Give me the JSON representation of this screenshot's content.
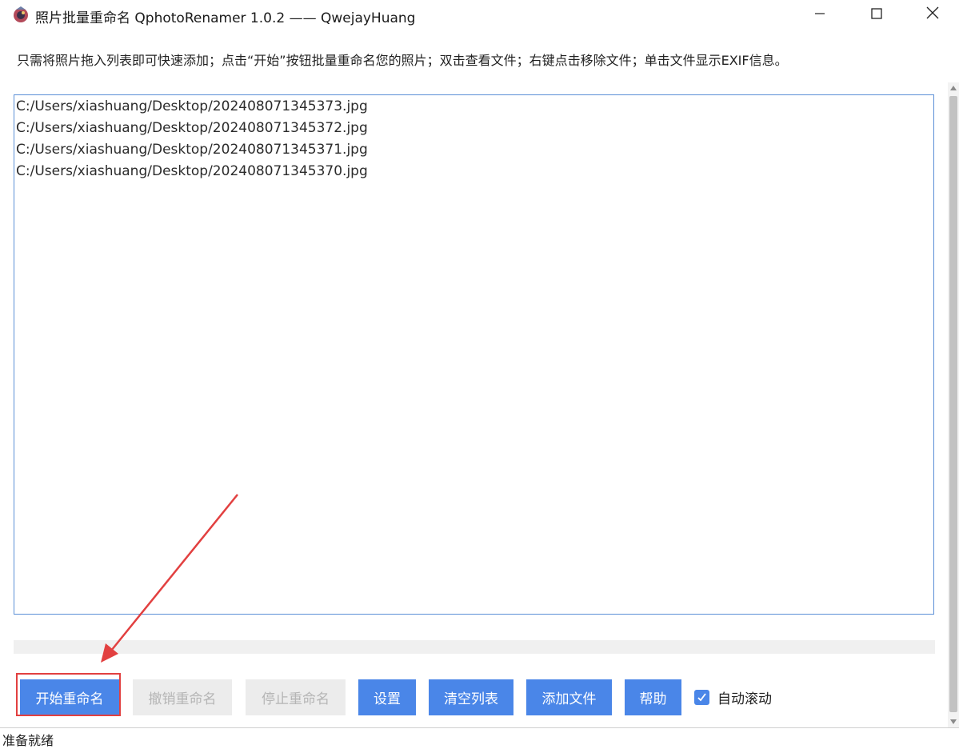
{
  "window": {
    "title": "照片批量重命名 QphotoRenamer 1.0.2 —— QwejayHuang",
    "icon": "app-photo-icon",
    "controls": {
      "minimize_icon": "minimize-icon",
      "maximize_icon": "maximize-icon",
      "close_icon": "close-icon"
    }
  },
  "hint": "只需将照片拖入列表即可快速添加；点击“开始”按钮批量重命名您的照片；双击查看文件；右键点击移除文件；单击文件显示EXIF信息。",
  "file_list": {
    "items": [
      "C:/Users/xiashuang/Desktop/202408071345373.jpg",
      "C:/Users/xiashuang/Desktop/202408071345372.jpg",
      "C:/Users/xiashuang/Desktop/202408071345371.jpg",
      "C:/Users/xiashuang/Desktop/202408071345370.jpg"
    ]
  },
  "progress": {
    "value": 0
  },
  "buttons": {
    "start": "开始重命名",
    "undo": "撤销重命名",
    "stop": "停止重命名",
    "settings": "设置",
    "clear": "清空列表",
    "add": "添加文件",
    "help": "帮助"
  },
  "auto_scroll": {
    "label": "自动滚动",
    "checked": true
  },
  "status": "准备就绪",
  "colors": {
    "accent": "#4a86e8",
    "disabled_bg": "#ececec",
    "disabled_text": "#b5b5b5",
    "annotation_red": "#e24040",
    "list_border": "#5b8fd6"
  }
}
